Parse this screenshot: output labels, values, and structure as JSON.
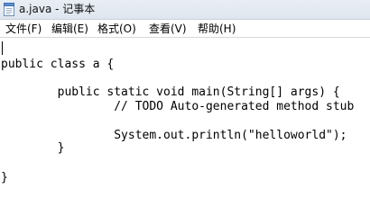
{
  "window": {
    "title": "a.java - 记事本"
  },
  "menu": {
    "items": [
      {
        "label": "文件(F)"
      },
      {
        "label": "编辑(E)"
      },
      {
        "label": "格式(O)"
      },
      {
        "label": "查看(V)"
      },
      {
        "label": "帮助(H)"
      }
    ]
  },
  "editor": {
    "lines": [
      "",
      "public class a {",
      "",
      "        public static void main(String[] args) {",
      "                // TODO Auto-generated method stub",
      "",
      "                System.out.println(\"helloworld\");",
      "        }",
      "",
      "}"
    ]
  },
  "icons": {
    "app": "notepad-icon"
  }
}
